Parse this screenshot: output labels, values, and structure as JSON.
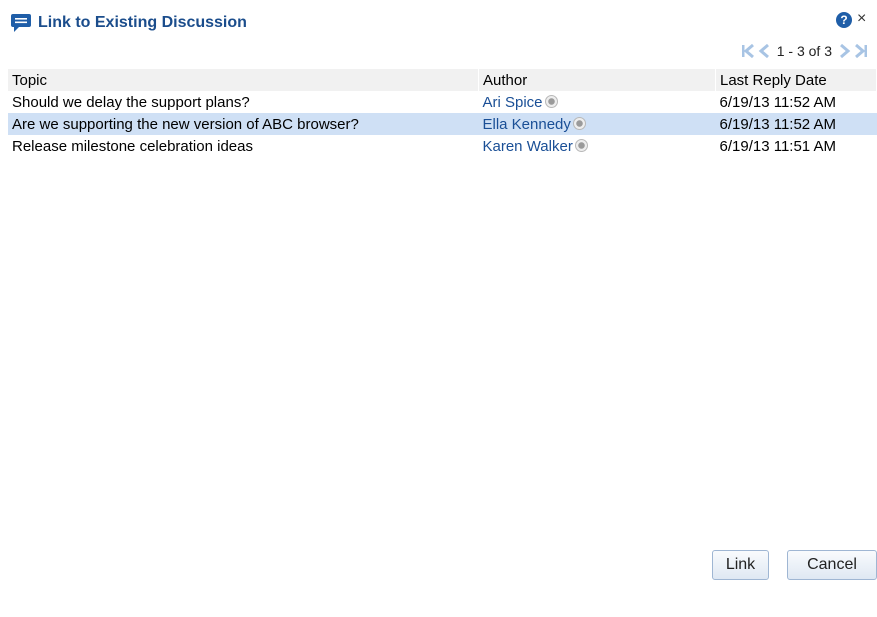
{
  "dialog": {
    "title": "Link to Existing Discussion",
    "help_label": "?",
    "close_label": "×"
  },
  "pager": {
    "range_text": "1 - 3 of 3"
  },
  "table": {
    "columns": [
      "Topic",
      "Author",
      "Last Reply Date"
    ],
    "rows": [
      {
        "topic": "Should we delay the support plans?",
        "author": "Ari Spice",
        "date": "6/19/13 11:52 AM",
        "selected": false
      },
      {
        "topic": "Are we supporting the new version of ABC browser?",
        "author": "Ella Kennedy",
        "date": "6/19/13 11:52 AM",
        "selected": true
      },
      {
        "topic": "Release milestone celebration ideas",
        "author": "Karen Walker",
        "date": "6/19/13 11:51 AM",
        "selected": false
      }
    ]
  },
  "buttons": {
    "link_label": "Link",
    "cancel_label": "Cancel"
  },
  "colors": {
    "accent": "#1b4d8c",
    "selected_row": "#cfe0f5",
    "link": "#1a4f96"
  }
}
